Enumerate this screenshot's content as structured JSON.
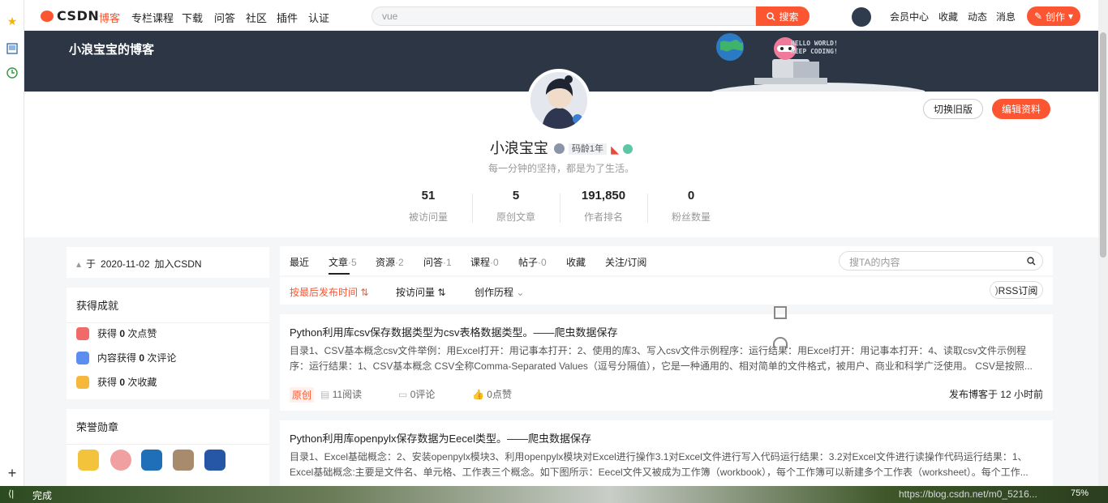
{
  "nav": {
    "logo": "CSDN",
    "links": [
      "博客",
      "专栏课程",
      "下载",
      "问答",
      "社区",
      "插件",
      "认证"
    ],
    "search_value": "vue",
    "search_button": "搜索",
    "right_links": [
      "会员中心",
      "收藏",
      "动态",
      "消息"
    ],
    "create_button": "创作"
  },
  "banner": {
    "blog_title": "小浪宝宝的博客",
    "hello_line1": "HELLO WORLD!",
    "hello_line2": "KEEP CODING!"
  },
  "profile": {
    "username": "小浪宝宝",
    "code_age": "码龄1年",
    "motto": "每一分钟的坚持，都是为了生活。",
    "switch_button": "切换旧版",
    "edit_button": "编辑资料",
    "stats": [
      {
        "value": "51",
        "label": "被访问量"
      },
      {
        "value": "5",
        "label": "原创文章"
      },
      {
        "value": "191,850",
        "label": "作者排名"
      },
      {
        "value": "0",
        "label": "粉丝数量"
      }
    ]
  },
  "sidebar": {
    "join_prefix": "于",
    "join_date": "2020-11-02",
    "join_suffix": "加入CSDN",
    "achievements_title": "获得成就",
    "achievements": [
      {
        "prefix": "获得",
        "count": "0",
        "suffix": "次点赞"
      },
      {
        "prefix": "内容获得",
        "count": "0",
        "suffix": "次评论"
      },
      {
        "prefix": "获得",
        "count": "0",
        "suffix": "次收藏"
      }
    ],
    "medals_title": "荣誉勋章"
  },
  "tabs": {
    "items": [
      {
        "label": "最近",
        "count": ""
      },
      {
        "label": "文章",
        "count": "·5"
      },
      {
        "label": "资源",
        "count": "·2"
      },
      {
        "label": "问答",
        "count": "·1"
      },
      {
        "label": "课程",
        "count": "·0"
      },
      {
        "label": "帖子",
        "count": "·0"
      },
      {
        "label": "收藏",
        "count": ""
      },
      {
        "label": "关注/订阅",
        "count": ""
      }
    ],
    "search_placeholder": "搜TA的内容"
  },
  "sort": {
    "by_time": "按最后发布时间",
    "by_views": "按访问量",
    "history": "创作历程",
    "rss": "RSS订阅"
  },
  "articles": [
    {
      "title": "Python利用库csv保存数据类型为csv表格数据类型。——爬虫数据保存",
      "desc": "目录1、CSV基本概念csv文件举例：用Excel打开：用记事本打开：2、使用的库3、写入csv文件示例程序：运行结果：用Excel打开：用记事本打开：4、读取csv文件示例程序：运行结果：1、CSV基本概念 CSV全称Comma-Separated Values（逗号分隔值），它是一种通用的、相对简单的文件格式，被用户、商业和科学广泛使用。 CSV是按照...",
      "tag": "原创",
      "views": "11阅读",
      "comments": "0评论",
      "likes": "0点赞",
      "published": "发布博客于 12 小时前"
    },
    {
      "title": "Python利用库openpylx保存数据为Eecel类型。——爬虫数据保存",
      "desc": "目录1、Excel基础概念：2、安装openpylx模块3、利用openpylx模块对Excel进行操作3.1对Excel文件进行写入代码运行结果：3.2对Excel文件进行读操作代码运行结果：1、Excel基础概念:主要是文件名、单元格、工作表三个概念。如下图所示：Eecel文件又被成为工作簿（workbook），每个工作簿可以新建多个工作表（worksheet）。每个工作..."
    }
  ],
  "status": {
    "text": "完成",
    "url": "https://blog.csdn.net/m0_5216...",
    "zoom": "75%"
  },
  "colors": {
    "accent": "#fc5531",
    "banner": "#2c3645"
  }
}
